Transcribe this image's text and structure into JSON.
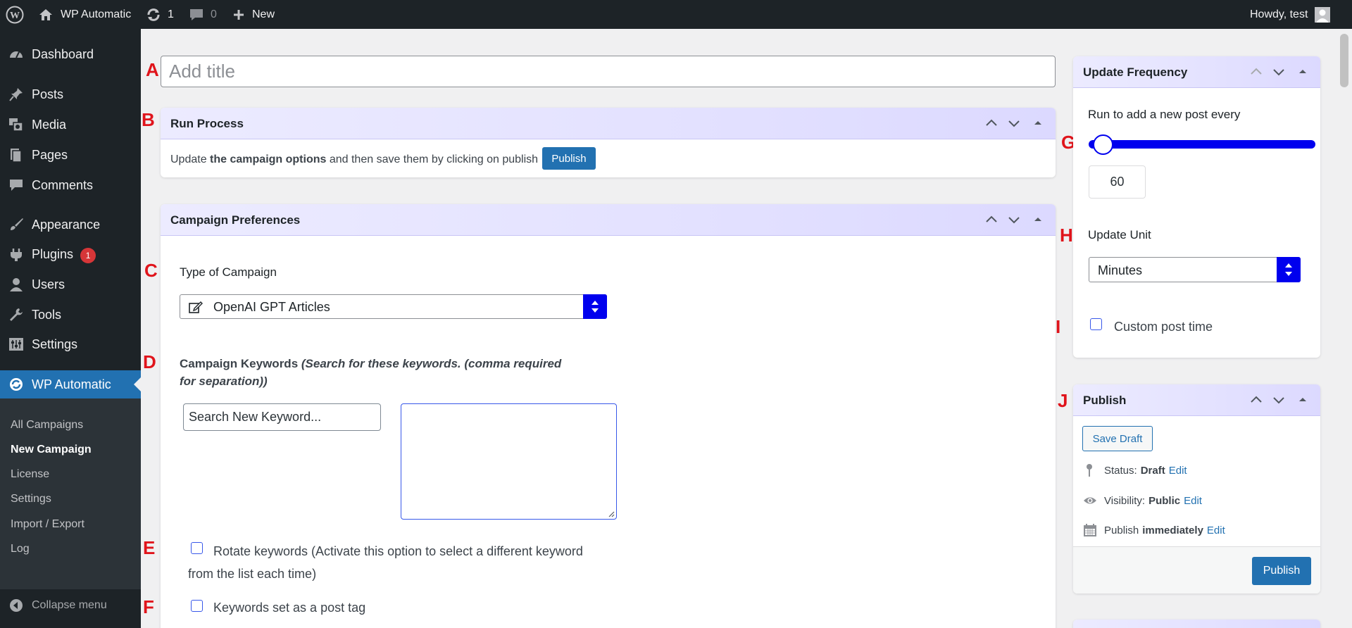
{
  "adminbar": {
    "site_name": "WP Automatic",
    "updates_count": "1",
    "comments_count": "0",
    "new_label": "New",
    "howdy": "Howdy, test"
  },
  "sidebar": {
    "items": [
      {
        "label": "Dashboard",
        "icon": "dashboard-icon"
      },
      {
        "label": "Posts",
        "icon": "pin-icon"
      },
      {
        "label": "Media",
        "icon": "media-icon"
      },
      {
        "label": "Pages",
        "icon": "pages-icon"
      },
      {
        "label": "Comments",
        "icon": "comment-icon"
      },
      {
        "label": "Appearance",
        "icon": "brush-icon"
      },
      {
        "label": "Plugins",
        "icon": "plug-icon",
        "badge": "1"
      },
      {
        "label": "Users",
        "icon": "user-icon"
      },
      {
        "label": "Tools",
        "icon": "wrench-icon"
      },
      {
        "label": "Settings",
        "icon": "settings-icon"
      },
      {
        "label": "WP Automatic",
        "icon": "wp-automatic-icon"
      }
    ],
    "submenu": [
      "All Campaigns",
      "New Campaign",
      "License",
      "Settings",
      "Import / Export",
      "Log"
    ],
    "collapse_label": "Collapse menu"
  },
  "annotations": [
    "A",
    "B",
    "C",
    "D",
    "E",
    "F",
    "G",
    "H",
    "I",
    "J"
  ],
  "title_placeholder": "Add title",
  "run_process": {
    "heading": "Run Process",
    "text_before": "Update ",
    "text_bold": "the campaign options",
    "text_after": " and then save them by clicking on publish",
    "publish_label": "Publish"
  },
  "campaign_prefs": {
    "heading": "Campaign Preferences",
    "type_label": "Type of Campaign",
    "type_value": "OpenAI GPT Articles",
    "keywords_label": "Campaign Keywords",
    "keywords_hint": "(Search for these keywords. (comma required for separation))",
    "search_placeholder": "Search New Keyword...",
    "keywords_value": "",
    "rotate_label": "Rotate keywords (Activate this option to select a different keyword from the list each time)",
    "tag_label": "Keywords set as a post tag"
  },
  "update_frequency": {
    "heading": "Update Frequency",
    "run_label": "Run to add a new post every",
    "value": "60",
    "slider_fraction": 0.02,
    "unit_label": "Update Unit",
    "unit_value": "Minutes",
    "custom_time_label": "Custom post time"
  },
  "publish_box": {
    "heading": "Publish",
    "save_draft": "Save Draft",
    "status_label": "Status:",
    "status_value": "Draft",
    "visibility_label": "Visibility:",
    "visibility_value": "Public",
    "publish_label": "Publish",
    "publish_value": "immediately",
    "edit_label": "Edit",
    "publish_button": "Publish"
  },
  "colors": {
    "admin_dark": "#1d2327",
    "wp_blue": "#2271b1",
    "accent_blue": "#0000ee",
    "annotation_red": "#e0141b"
  }
}
